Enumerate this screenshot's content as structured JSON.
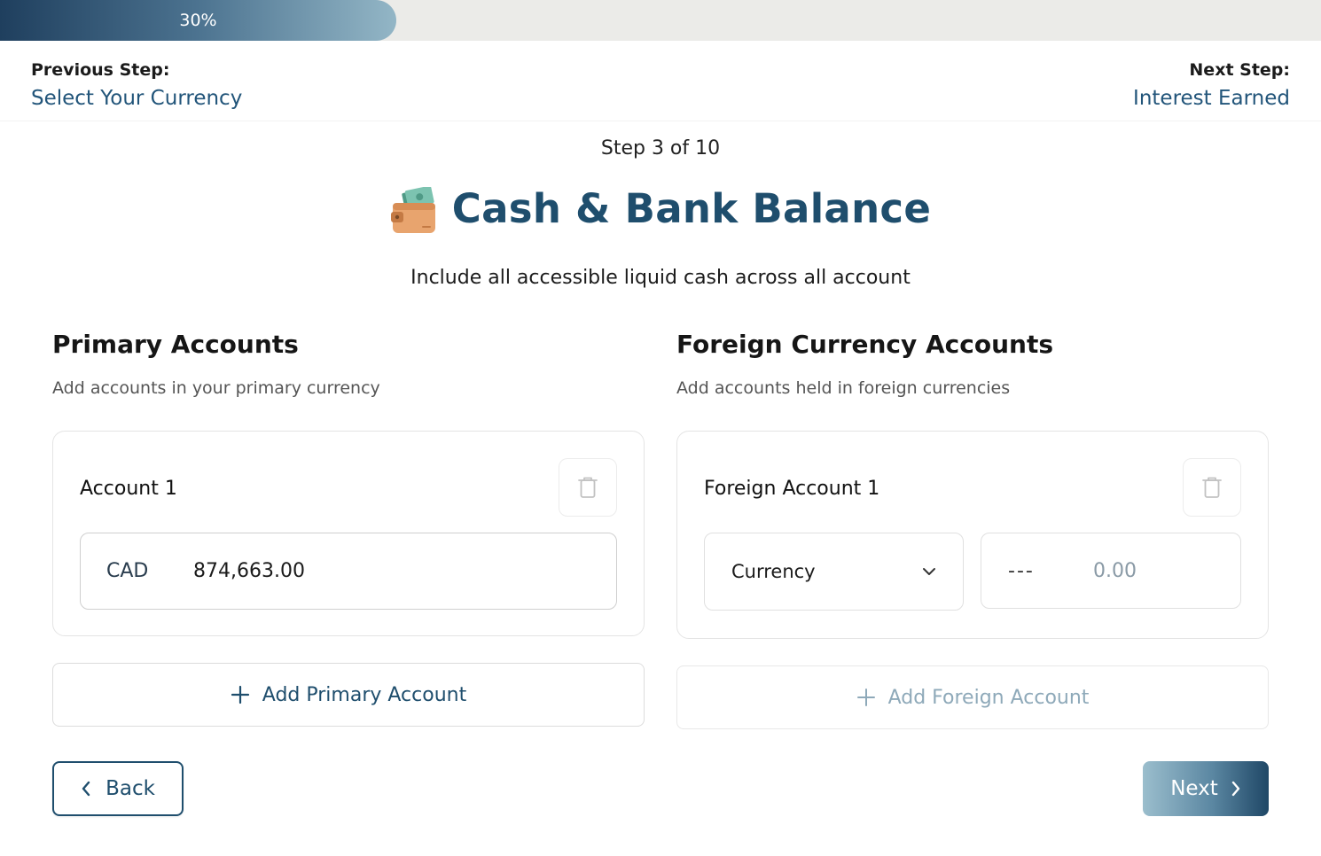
{
  "progress": {
    "percent_value": 30,
    "label": "30%"
  },
  "nav": {
    "previous_caption": "Previous Step:",
    "previous_link": "Select Your Currency",
    "next_caption": "Next Step:",
    "next_link": "Interest Earned"
  },
  "header": {
    "step_counter": "Step 3 of 10",
    "icon": "wallet-with-cash-icon",
    "title": "Cash & Bank Balance",
    "subtitle": "Include all accessible liquid cash across all account"
  },
  "primary": {
    "title": "Primary Accounts",
    "description": "Add accounts in your primary currency",
    "accounts": [
      {
        "label": "Account 1",
        "currency": "CAD",
        "amount": "874,663.00"
      }
    ],
    "add_label": "Add Primary Account"
  },
  "foreign": {
    "title": "Foreign Currency Accounts",
    "description": "Add accounts held in foreign currencies",
    "accounts": [
      {
        "label": "Foreign Account 1",
        "currency_select": "Currency",
        "code": "---",
        "amount_placeholder": "0.00"
      }
    ],
    "add_label": "Add Foreign Account"
  },
  "footer": {
    "back_label": "Back",
    "next_label": "Next"
  },
  "colors": {
    "brand": "#1f4e6d",
    "muted": "#8ea9b9",
    "track": "#ebebe8"
  }
}
